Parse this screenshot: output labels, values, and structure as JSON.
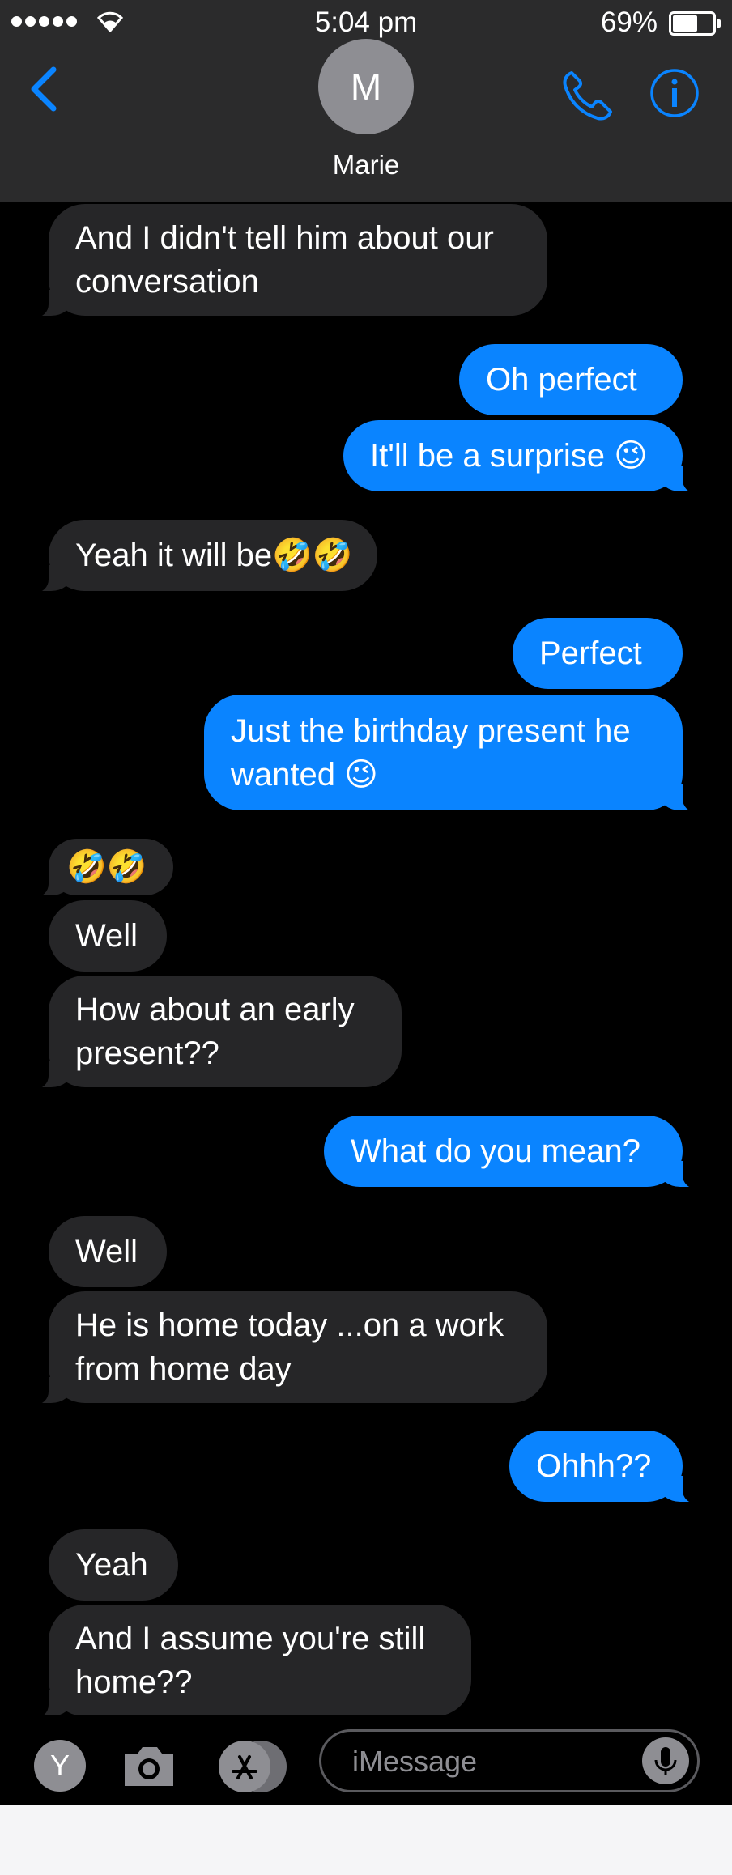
{
  "status_bar": {
    "time": "5:04 pm",
    "battery": "69%",
    "battery_level": 0.69
  },
  "header": {
    "avatar_initial": "M",
    "contact_name": "Marie"
  },
  "messages": [
    {
      "dir": "in",
      "text": "And I didn't tell him about our\nconversation"
    },
    {
      "dir": "out",
      "text": "Oh perfect"
    },
    {
      "dir": "out",
      "text": "It'll be a surprise 😉"
    },
    {
      "dir": "in",
      "text": "Yeah it will be🤣🤣"
    },
    {
      "dir": "out",
      "text": "Perfect"
    },
    {
      "dir": "out",
      "text": "Just the birthday present he\nwanted 😉"
    },
    {
      "dir": "in",
      "text": "🤣🤣"
    },
    {
      "dir": "in",
      "text": "Well"
    },
    {
      "dir": "in",
      "text": "How about an early\npresent??"
    },
    {
      "dir": "out",
      "text": "What do you mean?"
    },
    {
      "dir": "in",
      "text": "Well"
    },
    {
      "dir": "in",
      "text": "He is home today ...on a work\nfrom home day"
    },
    {
      "dir": "out",
      "text": "Ohhh??"
    },
    {
      "dir": "in",
      "text": "Yeah"
    },
    {
      "dir": "in",
      "text": "And I assume you're still\nhome??"
    }
  ],
  "input_bar": {
    "app_icon_letter": "Y",
    "placeholder": "iMessage"
  },
  "icons": {
    "back": "chevron-left-icon",
    "phone": "phone-icon",
    "info": "info-icon",
    "camera": "camera-icon",
    "appstore": "app-store-icon",
    "mic": "microphone-icon"
  },
  "colors": {
    "outgoing": "#0a84ff",
    "incoming": "#262628",
    "accent": "#0a84ff",
    "background": "#000000"
  }
}
